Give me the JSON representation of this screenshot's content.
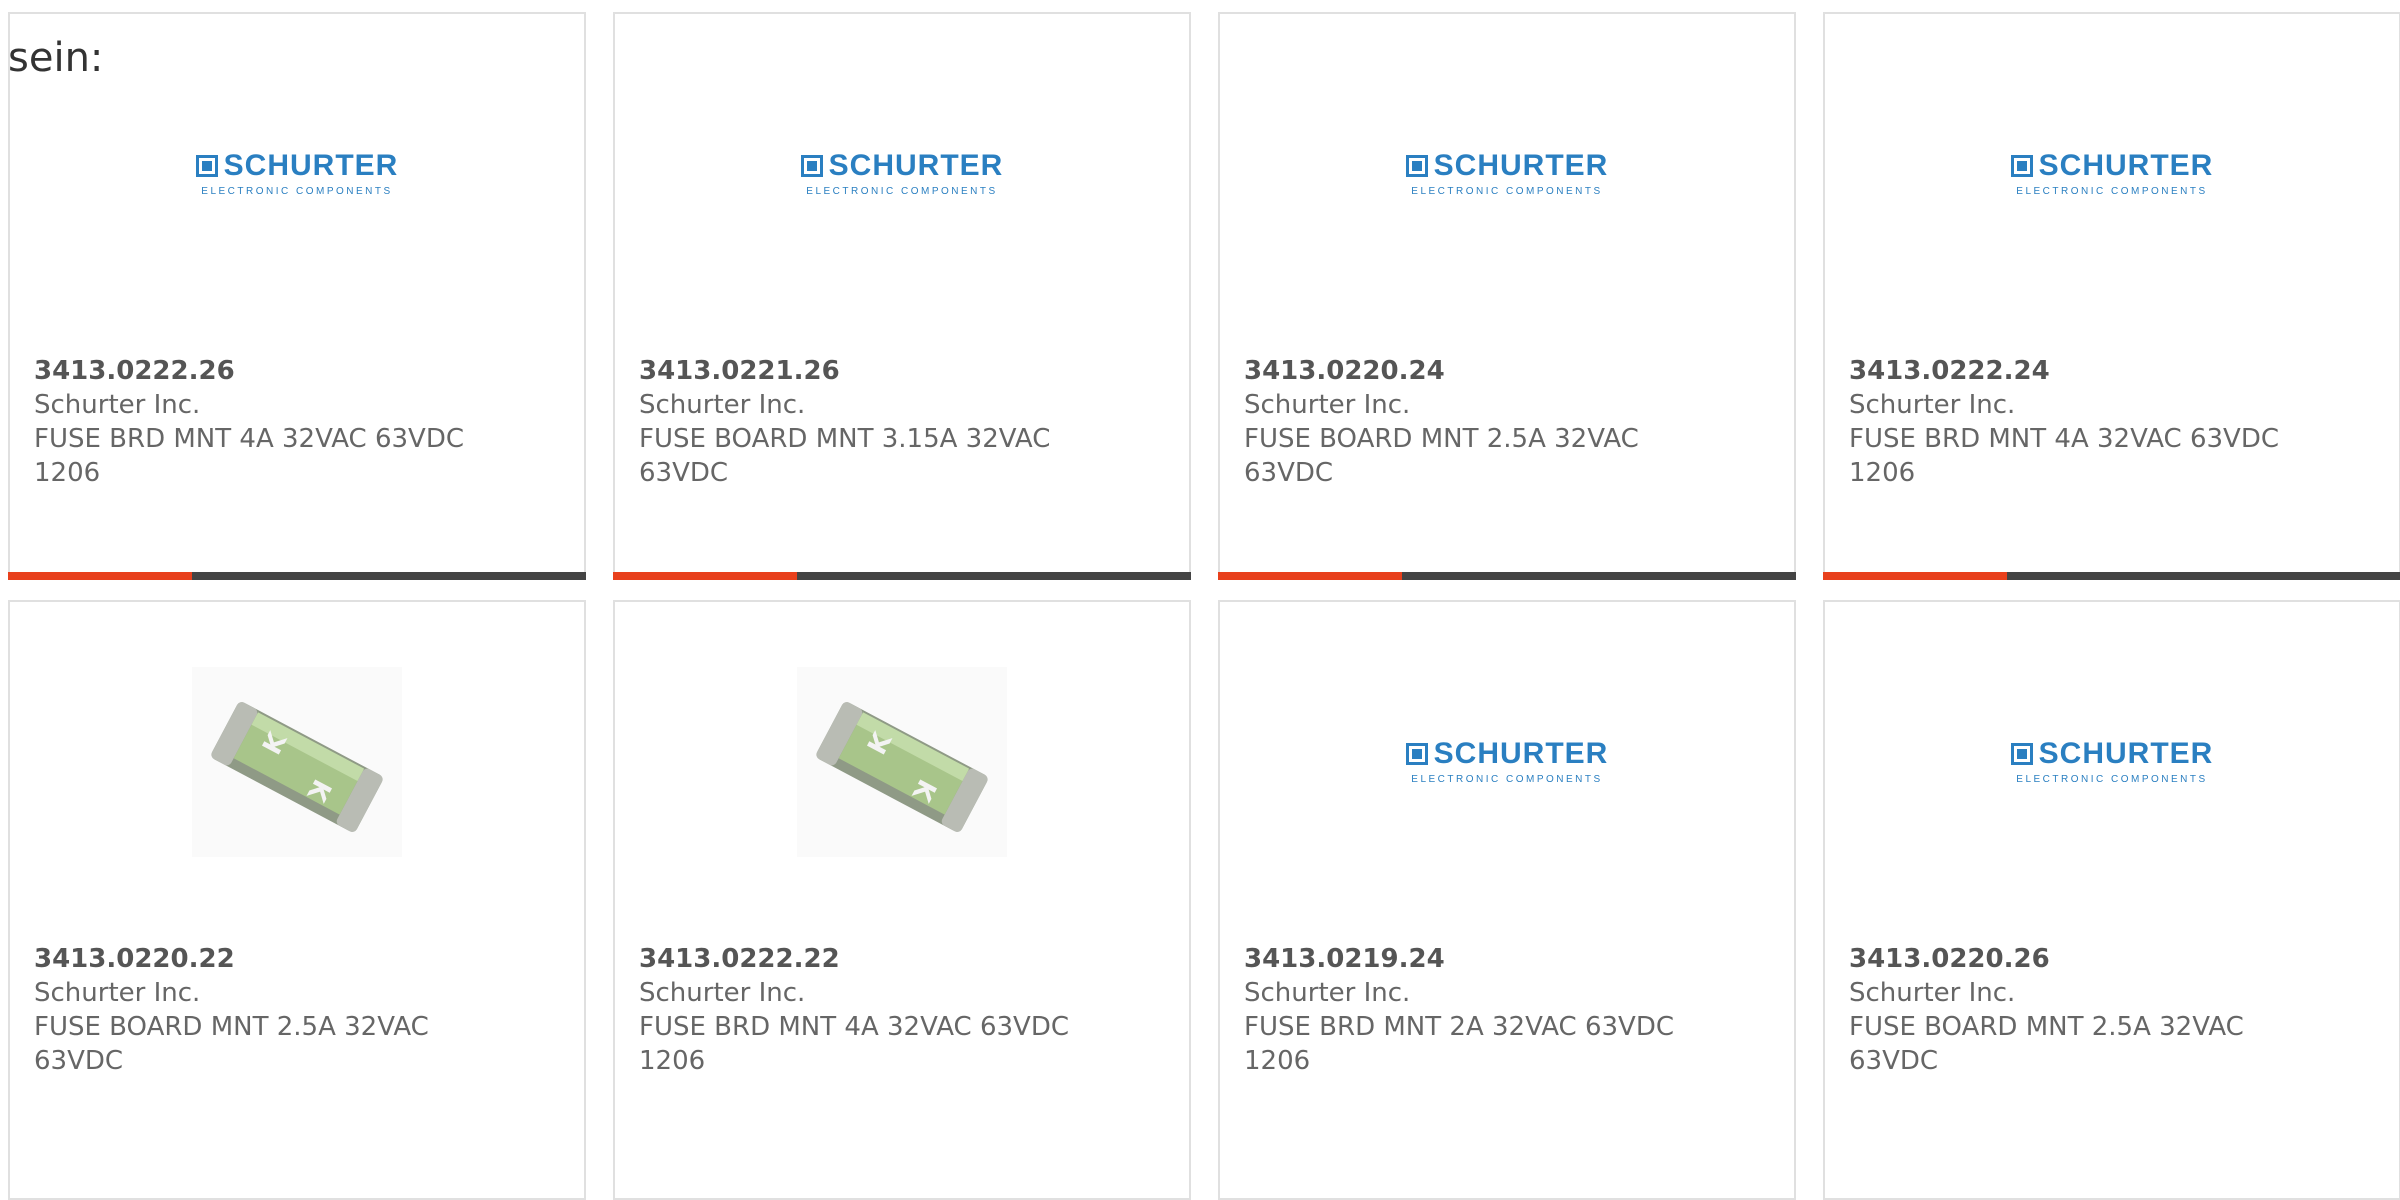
{
  "lead_text": "sein:",
  "products": [
    {
      "part_number": "3413.0222.26",
      "manufacturer": "Schurter Inc.",
      "description": "FUSE BRD MNT 4A 32VAC 63VDC 1206",
      "image": "schurter-logo"
    },
    {
      "part_number": "3413.0221.26",
      "manufacturer": "Schurter Inc.",
      "description": "FUSE BOARD MNT 3.15A 32VAC 63VDC",
      "image": "schurter-logo"
    },
    {
      "part_number": "3413.0220.24",
      "manufacturer": "Schurter Inc.",
      "description": "FUSE BOARD MNT 2.5A 32VAC 63VDC",
      "image": "schurter-logo"
    },
    {
      "part_number": "3413.0222.24",
      "manufacturer": "Schurter Inc.",
      "description": "FUSE BRD MNT 4A 32VAC 63VDC 1206",
      "image": "schurter-logo"
    },
    {
      "part_number": "3413.0220.22",
      "manufacturer": "Schurter Inc.",
      "description": "FUSE BOARD MNT 2.5A 32VAC 63VDC",
      "image": "fuse-photo"
    },
    {
      "part_number": "3413.0222.22",
      "manufacturer": "Schurter Inc.",
      "description": "FUSE BRD MNT 4A 32VAC 63VDC 1206",
      "image": "fuse-photo"
    },
    {
      "part_number": "3413.0219.24",
      "manufacturer": "Schurter Inc.",
      "description": "FUSE BRD MNT 2A 32VAC 63VDC 1206",
      "image": "schurter-logo"
    },
    {
      "part_number": "3413.0220.26",
      "manufacturer": "Schurter Inc.",
      "description": "FUSE BOARD MNT 2.5A 32VAC 63VDC",
      "image": "schurter-logo"
    }
  ],
  "logo": {
    "word": "SCHURTER",
    "subtitle": "ELECTRONIC COMPONENTS"
  },
  "colors": {
    "accent": "#e8401c",
    "bar": "#444444",
    "brand_blue": "#2a7fc1",
    "border": "#e0e0e0"
  }
}
